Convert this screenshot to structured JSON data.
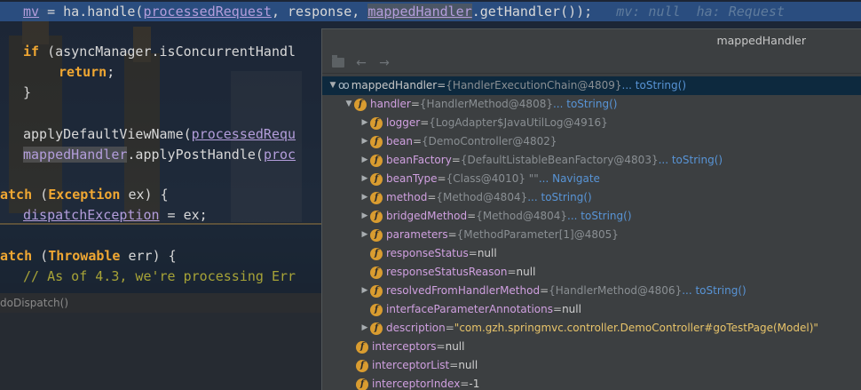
{
  "editor": {
    "line1": {
      "mv": "mv",
      "eq": " = ",
      "ha": "ha",
      "handle": ".handle(",
      "processedRequest": "processedRequest",
      "sep1": ", response, ",
      "mappedHandler": "mappedHandler",
      "tail": ".getHandler());",
      "hint": "   mv: null  ha: Request"
    },
    "line2": {
      "kw": "if",
      "rest": " (asyncManager.isConcurrentHandl"
    },
    "line3": {
      "kw": "return",
      "rest": ";"
    },
    "line4": "}",
    "line5": {
      "prefix": "applyDefaultViewName(",
      "arg": "processedRequ"
    },
    "line6": {
      "mappedHandler": "mappedHandler",
      "rest": ".applyPostHandle(",
      "arg": "proc"
    },
    "line7": {
      "kw1": "atch",
      "mid": " (",
      "kw2": "Exception",
      "rest": " ex) {"
    },
    "line8": {
      "var": "dispatchException",
      "rest": " = ex;"
    },
    "line9": {
      "kw1": "atch",
      "mid": " (",
      "kw2": "Throwable",
      "rest": " err) {"
    },
    "line10": "// As of 4.3, we're processing Err",
    "breadcrumb": "doDispatch()"
  },
  "popup": {
    "title": "mappedHandler",
    "rows": [
      {
        "name": "mappedHandler",
        "eq": " = ",
        "value": "{HandlerExecutionChain@4809}",
        "link": " ... toString()"
      },
      {
        "name": "handler",
        "eq": " = ",
        "value": "{HandlerMethod@4808}",
        "link": " ... toString()"
      },
      {
        "name": "logger",
        "eq": " = ",
        "value": "{LogAdapter$JavaUtilLog@4916}"
      },
      {
        "name": "bean",
        "eq": " = ",
        "value": "{DemoController@4802}"
      },
      {
        "name": "beanFactory",
        "eq": " = ",
        "value": "{DefaultListableBeanFactory@4803}",
        "link": " ... toString()"
      },
      {
        "name": "beanType",
        "eq": " = ",
        "value": "{Class@4010} \"\"",
        "link": " ... Navigate"
      },
      {
        "name": "method",
        "eq": " = ",
        "value": "{Method@4804}",
        "link": " ... toString()"
      },
      {
        "name": "bridgedMethod",
        "eq": " = ",
        "value": "{Method@4804}",
        "link": " ... toString()"
      },
      {
        "name": "parameters",
        "eq": " = ",
        "value": "{MethodParameter[1]@4805}"
      },
      {
        "name": "responseStatus",
        "eq": " = ",
        "value": "null"
      },
      {
        "name": "responseStatusReason",
        "eq": " = ",
        "value": "null"
      },
      {
        "name": "resolvedFromHandlerMethod",
        "eq": " = ",
        "value": "{HandlerMethod@4806}",
        "link": " ... toString()"
      },
      {
        "name": "interfaceParameterAnnotations",
        "eq": " = ",
        "value": "null"
      },
      {
        "name": "description",
        "eq": " = ",
        "value": "\"com.gzh.springmvc.controller.DemoController#goTestPage(Model)\""
      },
      {
        "name": "interceptors",
        "eq": " = ",
        "value": "null"
      },
      {
        "name": "interceptorList",
        "eq": " = ",
        "value": "null"
      },
      {
        "name": "interceptorIndex",
        "eq": " = ",
        "value": "-1"
      }
    ]
  },
  "icons": {
    "expanded": "triangle-down-icon",
    "collapsed": "triangle-right-icon",
    "field": "field-f-icon",
    "watch": "infinity-watch-icon",
    "back": "back-arrow-icon",
    "forward": "forward-arrow-icon",
    "folder": "folder-icon"
  },
  "colors": {
    "selection": "#0d293e",
    "link": "#5894d6",
    "field_badge": "#d99c30",
    "string": "#e8c46a"
  }
}
